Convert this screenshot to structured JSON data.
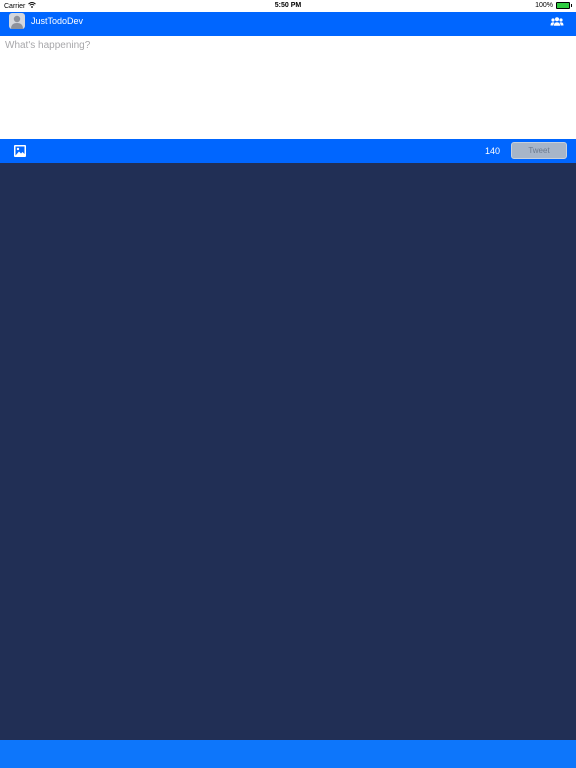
{
  "status_bar": {
    "carrier": "Carrier",
    "time": "5:50 PM",
    "battery_percent": "100%",
    "battery_level": 1.0,
    "wifi_icon": "wifi-icon"
  },
  "navbar": {
    "username": "JustTodoDev",
    "avatar_icon": "default-avatar-icon",
    "people_icon": "people-icon"
  },
  "compose": {
    "placeholder": "What's happening?",
    "value": ""
  },
  "toolbar": {
    "photo_icon": "photo-icon",
    "char_count": "140",
    "tweet_label": "Tweet"
  },
  "colors": {
    "nav_blue": "#0066ff",
    "content_navy": "#212f55",
    "bottom_bar_blue": "#0d76fb",
    "tweet_disabled": "#a7b5c8"
  }
}
